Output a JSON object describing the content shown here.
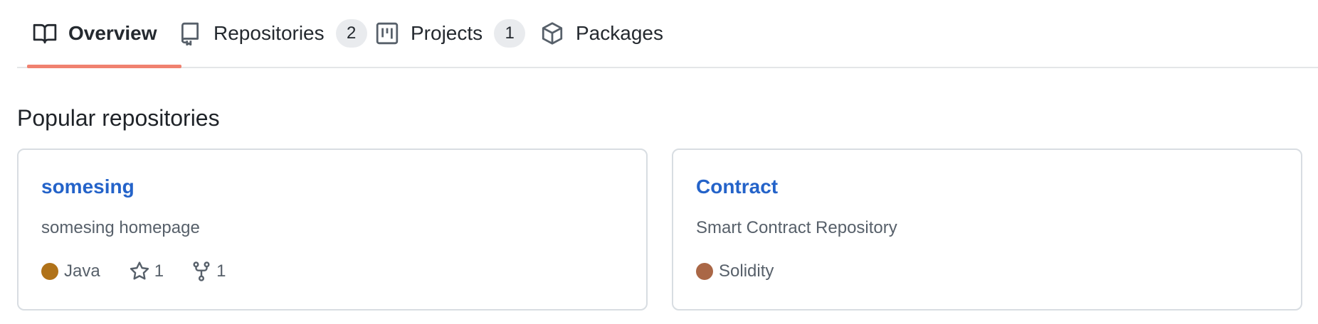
{
  "tabs": [
    {
      "label": "Overview",
      "icon": "book-icon",
      "active": true
    },
    {
      "label": "Repositories",
      "icon": "repo-icon",
      "count": "2"
    },
    {
      "label": "Projects",
      "icon": "project-icon",
      "count": "1"
    },
    {
      "label": "Packages",
      "icon": "package-icon"
    }
  ],
  "section": {
    "title": "Popular repositories"
  },
  "repos": [
    {
      "name": "somesing",
      "description": "somesing homepage",
      "language": "Java",
      "language_color": "#b07219",
      "stars": "1",
      "forks": "1"
    },
    {
      "name": "Contract",
      "description": "Smart Contract Repository",
      "language": "Solidity",
      "language_color": "#AA6746"
    }
  ],
  "colors": {
    "accent_underline": "#f0816f",
    "link": "#2463c9",
    "counter_bg": "#e9ebee"
  }
}
